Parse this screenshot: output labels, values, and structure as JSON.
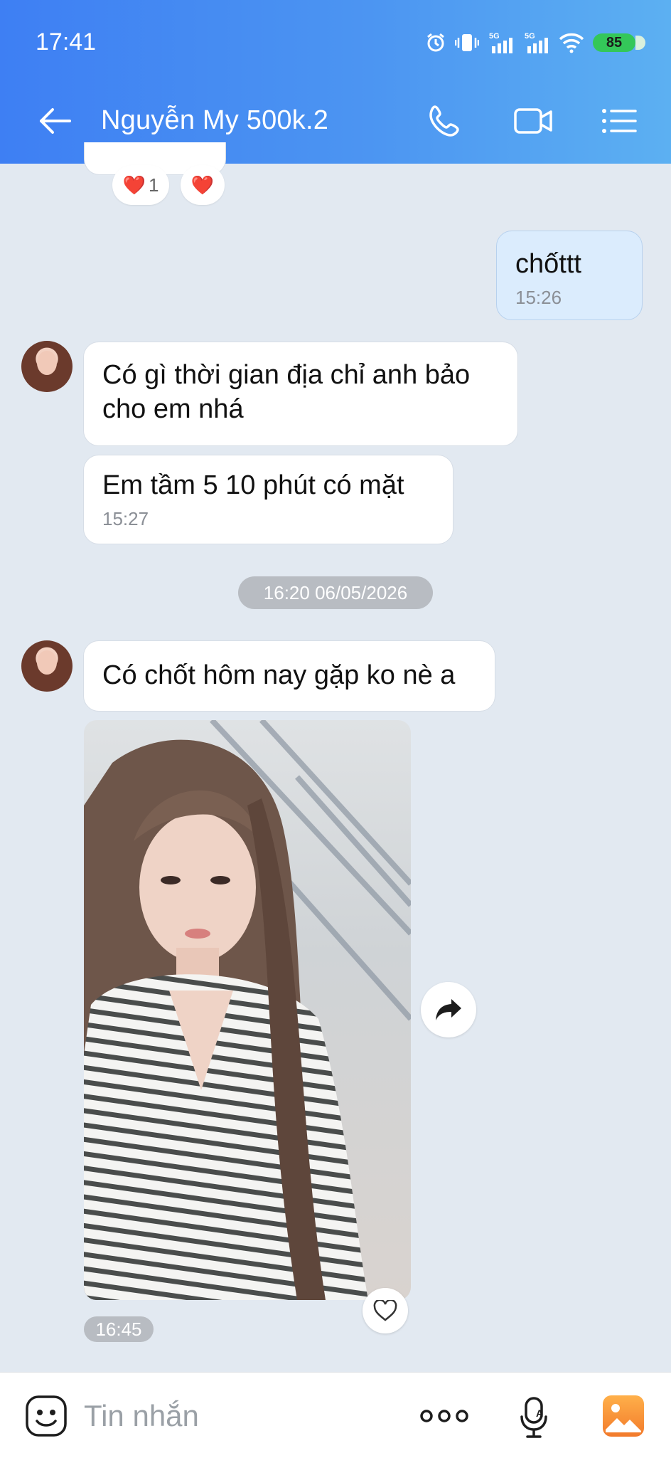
{
  "status_bar": {
    "time": "17:41",
    "battery": "85",
    "network_1": "5G",
    "network_2": "5G"
  },
  "header": {
    "title": "Nguyễn My 500k.2",
    "back_icon": "arrow-left-icon",
    "call_icon": "phone-icon",
    "video_icon": "video-camera-icon",
    "menu_icon": "list-menu-icon",
    "gradient_start": "#3e7ff3",
    "gradient_end": "#5cb0f2"
  },
  "reactions": {
    "first_count": "1",
    "emoji": "❤️"
  },
  "messages": [
    {
      "sender": "me",
      "text": "chốttt",
      "time": "15:26"
    },
    {
      "sender": "them",
      "text": "Có gì thời gian địa chỉ anh bảo cho em nhá"
    },
    {
      "sender": "them",
      "text": "Em tầm 5 10  phút có mặt",
      "time": "15:27"
    }
  ],
  "date_separator": "16:20 06/05/2026",
  "later_messages": [
    {
      "sender": "them",
      "text": "Có chốt hôm nay gặp ko nè a"
    }
  ],
  "photo_time": "16:45",
  "composer": {
    "placeholder": "Tin nhắn",
    "more_icon": "more-dots-icon",
    "mic_icon": "microphone-icon",
    "gallery_icon": "image-gallery-icon"
  },
  "colors": {
    "background": "#e2e9f1",
    "my_bubble": "#dbecfd",
    "their_bubble": "#ffffff",
    "chip": "#b8bcc2"
  }
}
